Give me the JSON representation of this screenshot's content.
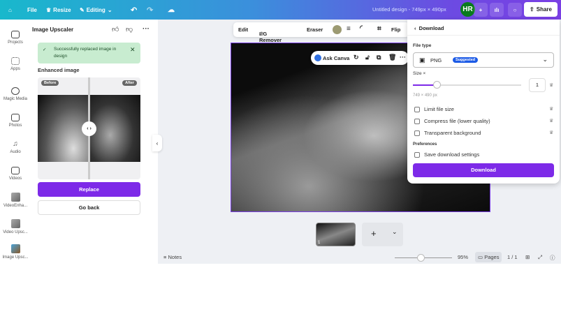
{
  "topbar": {
    "file": "File",
    "resize": "Resize",
    "editing": "Editing",
    "design_title": "Untitled design - 749px × 490px",
    "avatar": "HR",
    "share": "Share"
  },
  "rail": [
    {
      "label": "Projects"
    },
    {
      "label": "Apps"
    },
    {
      "label": "Magic Media"
    },
    {
      "label": "Photos"
    },
    {
      "label": "Audio"
    },
    {
      "label": "Videos"
    },
    {
      "label": "VideoEnha..."
    },
    {
      "label": "Video Upsc..."
    },
    {
      "label": "Image Upsc..."
    }
  ],
  "panel": {
    "title": "Image Upscaler",
    "alert": "Successfully replaced image in design",
    "enhanced": "Enhanced image",
    "before": "Before",
    "after": "After",
    "replace": "Replace",
    "go_back": "Go back"
  },
  "toolbar": {
    "edit": "Edit",
    "bg_remover": "BG Remover",
    "eraser": "Eraser",
    "flip": "Flip",
    "swatch_color": "#9c9a72"
  },
  "ask": {
    "label": "Ask Canva"
  },
  "download": {
    "title": "Download",
    "file_type_label": "File type",
    "file_type": "PNG",
    "suggested": "Suggested",
    "size_label": "Size ×",
    "size_value": "1",
    "size_fraction": 0.22,
    "dims": "749 × 490 px",
    "options": [
      "Limit file size",
      "Compress file (lower quality)",
      "Transparent background"
    ],
    "preferences": "Preferences",
    "save_settings": "Save download settings",
    "button": "Download"
  },
  "footer": {
    "page_num": "1",
    "notes": "Notes",
    "zoom": "95%",
    "zoom_fraction": 0.45,
    "pages": "Pages",
    "page_count": "1 / 1"
  }
}
